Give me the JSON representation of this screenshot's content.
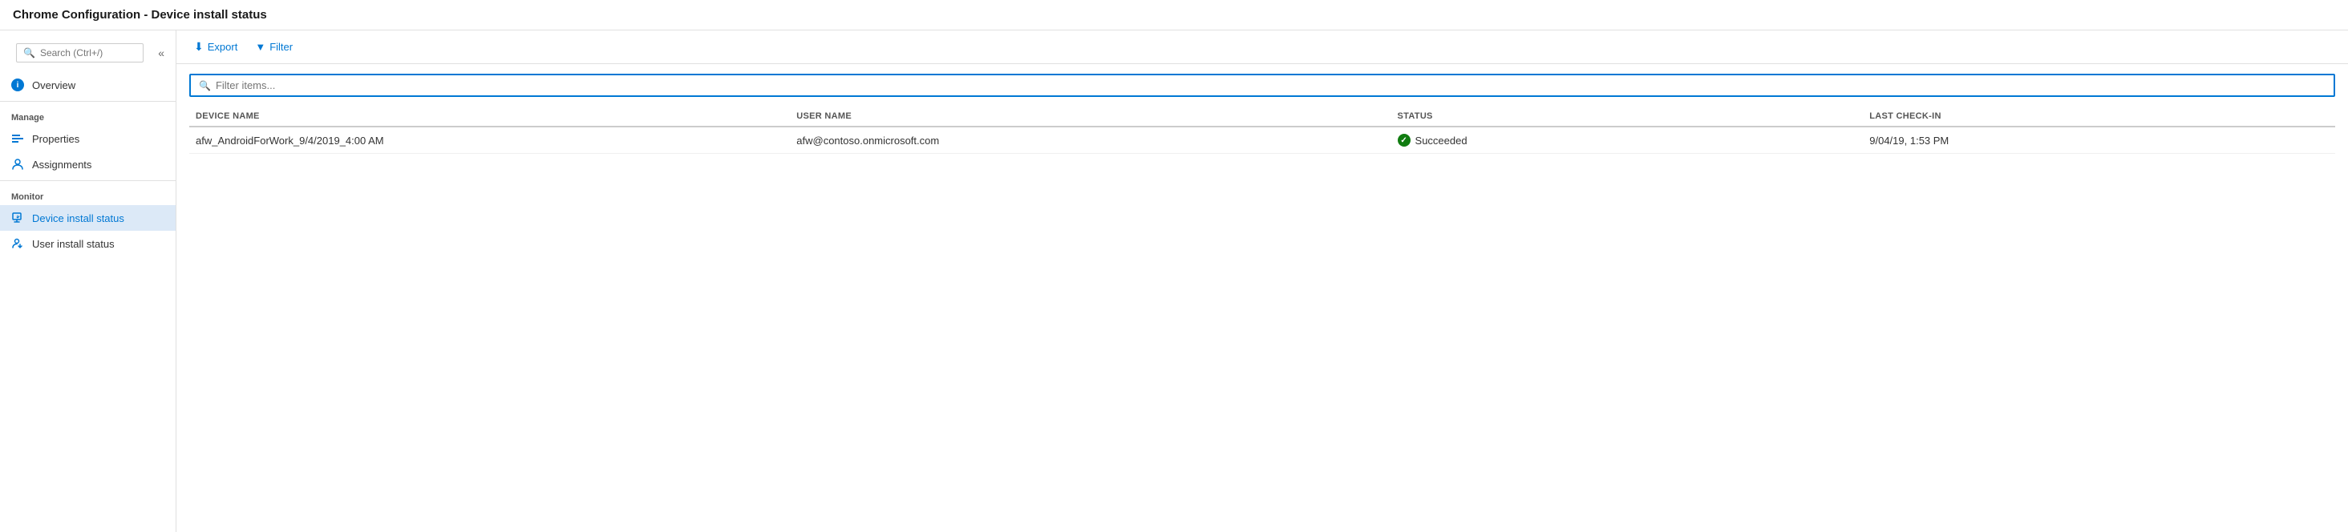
{
  "titleBar": {
    "title": "Chrome Configuration - Device install status"
  },
  "sidebar": {
    "search": {
      "placeholder": "Search (Ctrl+/)"
    },
    "sections": [
      {
        "name": "top",
        "items": [
          {
            "id": "overview",
            "label": "Overview",
            "icon": "info-icon",
            "active": false
          }
        ]
      },
      {
        "name": "Manage",
        "items": [
          {
            "id": "properties",
            "label": "Properties",
            "icon": "properties-icon",
            "active": false
          },
          {
            "id": "assignments",
            "label": "Assignments",
            "icon": "assignments-icon",
            "active": false
          }
        ]
      },
      {
        "name": "Monitor",
        "items": [
          {
            "id": "device-install-status",
            "label": "Device install status",
            "icon": "device-install-icon",
            "active": true
          },
          {
            "id": "user-install-status",
            "label": "User install status",
            "icon": "user-install-icon",
            "active": false
          }
        ]
      }
    ]
  },
  "toolbar": {
    "export_label": "Export",
    "filter_label": "Filter"
  },
  "table": {
    "filter_placeholder": "Filter items...",
    "columns": [
      {
        "id": "device_name",
        "label": "DEVICE NAME"
      },
      {
        "id": "user_name",
        "label": "USER NAME"
      },
      {
        "id": "status",
        "label": "STATUS"
      },
      {
        "id": "last_checkin",
        "label": "LAST CHECK-IN"
      }
    ],
    "rows": [
      {
        "device_name": "afw_AndroidForWork_9/4/2019_4:00 AM",
        "user_name": "afw@contoso.onmicrosoft.com",
        "status": "Succeeded",
        "last_checkin": "9/04/19, 1:53 PM"
      }
    ]
  }
}
